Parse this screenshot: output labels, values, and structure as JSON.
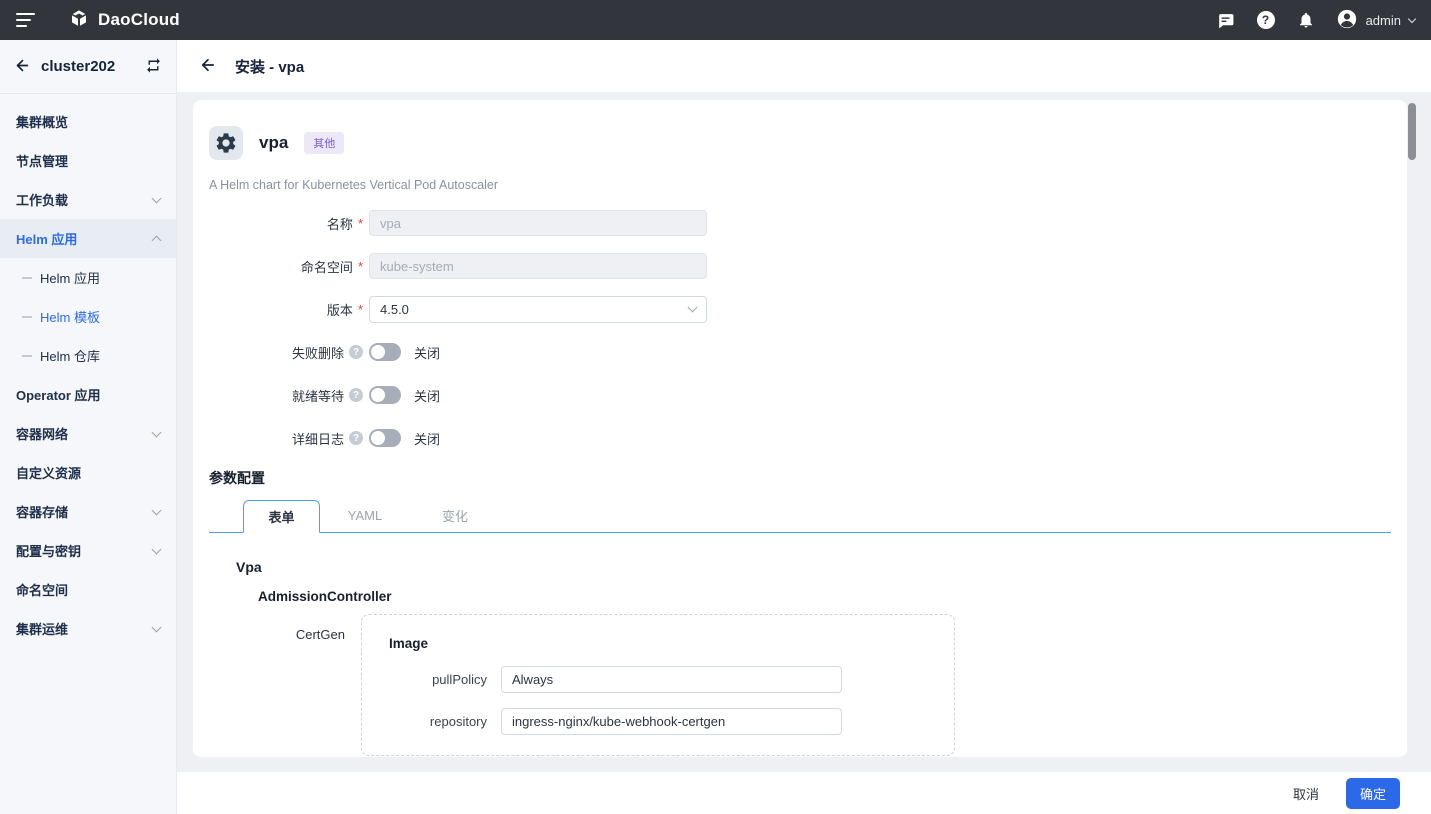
{
  "colors": {
    "topbar_bg": "#32353b",
    "accent_blue": "#2e6be6",
    "tab_line_blue": "#4aa0f7",
    "primary_button_blue": "#2b69e8",
    "tag_bg": "#ece8f7",
    "tag_text": "#7c5cd6",
    "required_red": "#f03e3e"
  },
  "topbar": {
    "brand": "DaoCloud",
    "user_name": "admin",
    "help_glyph": "?"
  },
  "sidebar": {
    "cluster_name": "cluster202",
    "items": [
      {
        "label": "集群概览"
      },
      {
        "label": "节点管理"
      },
      {
        "label": "工作负载",
        "chevron": "down"
      },
      {
        "label": "Helm 应用",
        "chevron": "up",
        "active": true
      },
      {
        "label": "Helm 应用",
        "sub": true
      },
      {
        "label": "Helm 模板",
        "sub": true,
        "active": true
      },
      {
        "label": "Helm 仓库",
        "sub": true
      },
      {
        "label": "Operator 应用"
      },
      {
        "label": "容器网络",
        "chevron": "down"
      },
      {
        "label": "自定义资源"
      },
      {
        "label": "容器存储",
        "chevron": "down"
      },
      {
        "label": "配置与密钥",
        "chevron": "down"
      },
      {
        "label": "命名空间"
      },
      {
        "label": "集群运维",
        "chevron": "down"
      }
    ]
  },
  "page": {
    "title": "安装 - vpa"
  },
  "app": {
    "name": "vpa",
    "category_tag": "其他",
    "description": "A Helm chart for Kubernetes Vertical Pod Autoscaler"
  },
  "install_form": {
    "name": {
      "label": "名称",
      "placeholder": "vpa"
    },
    "namespace": {
      "label": "命名空间",
      "placeholder": "kube-system"
    },
    "version": {
      "label": "版本",
      "value": "4.5.0"
    },
    "help_glyph": "?",
    "toggles": [
      {
        "label": "失败删除",
        "state_label": "关闭",
        "on": false
      },
      {
        "label": "就绪等待",
        "state_label": "关闭",
        "on": false
      },
      {
        "label": "详细日志",
        "state_label": "关闭",
        "on": false
      }
    ]
  },
  "params": {
    "title": "参数配置",
    "tabs": [
      {
        "label": "表单",
        "active": true
      },
      {
        "label": "YAML"
      },
      {
        "label": "变化"
      }
    ],
    "root_heading": "Vpa",
    "group_heading": "AdmissionController",
    "field_group_label": "CertGen",
    "box_title": "Image",
    "fields": [
      {
        "label": "pullPolicy",
        "value": "Always"
      },
      {
        "label": "repository",
        "value": "ingress-nginx/kube-webhook-certgen"
      }
    ]
  },
  "footer": {
    "cancel_label": "取消",
    "confirm_label": "确定"
  }
}
